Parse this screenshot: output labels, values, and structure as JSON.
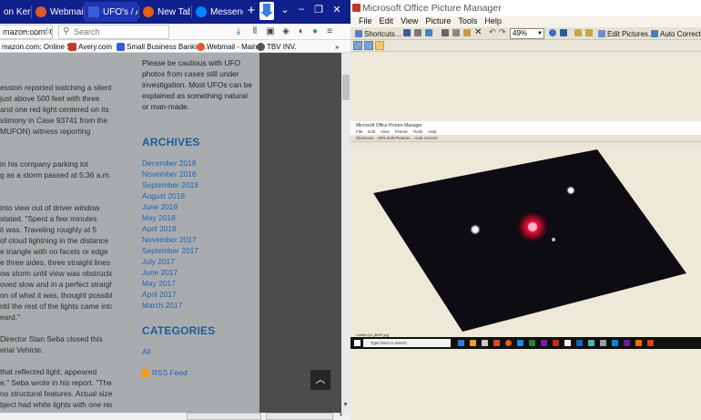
{
  "firefox": {
    "tabs": [
      {
        "title": "on Kerr -",
        "icon_color": "#8a8a8a"
      },
      {
        "title": "Webmail -",
        "icon_color": "#e0572a"
      },
      {
        "title": "UFO's / Au",
        "icon_color": "#3a5bd6"
      },
      {
        "title": "New Tab",
        "icon_color": "#e66000"
      },
      {
        "title": "Messenger",
        "icon_color": "#0084ff"
      }
    ],
    "url_text": "mazon.com: Online S...",
    "search_placeholder": "Search",
    "bookmarks": [
      {
        "label": "Avery.com",
        "icon_color": "#c0392b"
      },
      {
        "label": "Small Business Bankin...",
        "icon_color": "#3a5bd6"
      },
      {
        "label": "Webmail - Main",
        "icon_color": "#e0572a"
      },
      {
        "label": "TBV INV.",
        "icon_color": "#555555"
      }
    ],
    "article_lines": [
      "esston reported watching a silent,",
      "just above 500 feet with three",
      "and one red light centered on its",
      "stimony in Case 93741 from the",
      "MUFON) witness reporting",
      "",
      "in his company parking lot",
      "g as a storm passed at 5:36 a.m.",
      "",
      "into view out of driver window",
      "stated. \"Spent a few minutes",
      "it was. Traveling roughly at 5",
      "of cloud lightning in the distance",
      "e triangle with no facets or edge",
      "e three sides, three straight lines",
      "ow storm until view was obstructed",
      "oved slow and in a perfect straight",
      "on of what it was, thought possibly",
      "ntil the rest of the lights came into",
      "eard.\"",
      "",
      "Director Stan Seba closed this",
      "erial Vehicle.",
      "",
      "that reflected light, appeared",
      "e,\" Seba wrote in his report. \"The",
      "no structural features. Actual size",
      "bject had white lights with one red"
    ],
    "caution_text": "Please be cautious with UFO photos from cases still under investigation. Most UFOs can be explained as something natural or man-made.",
    "archives_heading": "ARCHIVES",
    "archives": [
      "December 2018",
      "November 2018",
      "September 2018",
      "August 2018",
      "June 2018",
      "May 2018",
      "April 2018",
      "November 2017",
      "September 2017",
      "July 2017",
      "June 2017",
      "May 2017",
      "April 2017",
      "March 2017"
    ],
    "categories_heading": "CATEGORIES",
    "categories": [
      "All"
    ],
    "rss_label": "RSS Feed"
  },
  "picture_manager": {
    "title": "Microsoft Office Picture Manager",
    "menu": [
      "File",
      "Edit",
      "View",
      "Picture",
      "Tools",
      "Help"
    ],
    "shortcuts_label": "Shortcuts...",
    "zoom_value": "49%",
    "edit_pictures_label": "Edit Pictures...",
    "auto_correct_label": "Auto Correct",
    "embedded": {
      "title": "Microsoft Office Picture Manager",
      "menu": [
        "File",
        "Edit",
        "View",
        "Picture",
        "Tools",
        "Help"
      ],
      "toolbar_text": "Shortcuts...   49%   Edit Pictures...   Auto Correct",
      "status_text": "Untitled(1)  [BMP,jpg]",
      "taskbar_search": "Type here to search"
    },
    "photo_colors": {
      "sky": "#0c0c12",
      "red_light": "#e8103a",
      "white_light": "#f4f4f4"
    }
  }
}
